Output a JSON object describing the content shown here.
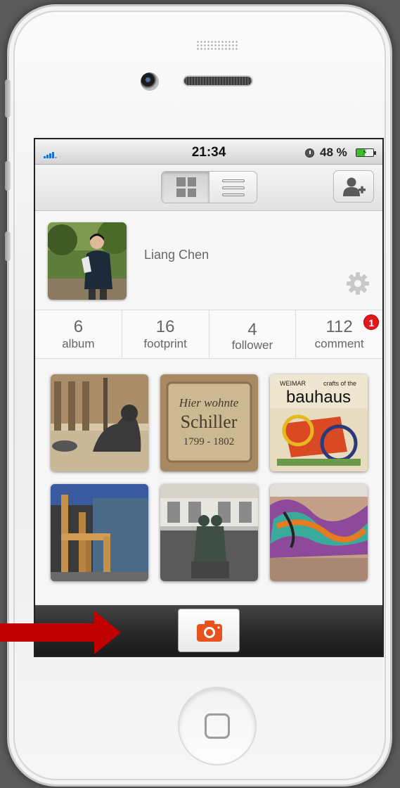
{
  "status_bar": {
    "time": "21:34",
    "battery_percent": "48 %",
    "battery_level": 0.48,
    "signal_icon": "signal-bars-icon",
    "alarm_icon": "clock-icon",
    "battery_icon": "battery-charging-icon"
  },
  "toolbar": {
    "view_modes": [
      "grid-view-icon",
      "list-view-icon"
    ],
    "active_view": "grid",
    "add_friend_icon": "add-user-icon"
  },
  "profile": {
    "name": "Liang Chen",
    "settings_icon": "gear-icon"
  },
  "stats": [
    {
      "value": "6",
      "label": "album"
    },
    {
      "value": "16",
      "label": "footprint"
    },
    {
      "value": "4",
      "label": "follower"
    },
    {
      "value": "112",
      "label": "comment",
      "badge": "1"
    }
  ],
  "photos": [
    {
      "caption": "",
      "subject": "reclining statue in courtyard"
    },
    {
      "caption": "Hier wohnte Schiller 1799 - 1802",
      "subject": "stone plaque"
    },
    {
      "caption": "WEIMAR crafts of the bauhaus",
      "subject": "bauhaus book cover"
    },
    {
      "caption": "",
      "subject": "wooden chair sculpture"
    },
    {
      "caption": "",
      "subject": "goethe schiller monument"
    },
    {
      "caption": "",
      "subject": "graffiti wall"
    }
  ],
  "photo_text": {
    "schiller_line1": "Hier wohnte",
    "schiller_line2": "Schiller",
    "schiller_line3": "1799 - 1802",
    "bauhaus_top_left": "WEIMAR",
    "bauhaus_top_right": "crafts of the",
    "bauhaus_title": "bauhaus"
  },
  "tabbar": {
    "camera_icon": "camera-icon"
  },
  "colors": {
    "accent": "#e8501c",
    "badge": "#e0191e",
    "annotation_arrow": "#c00000"
  }
}
